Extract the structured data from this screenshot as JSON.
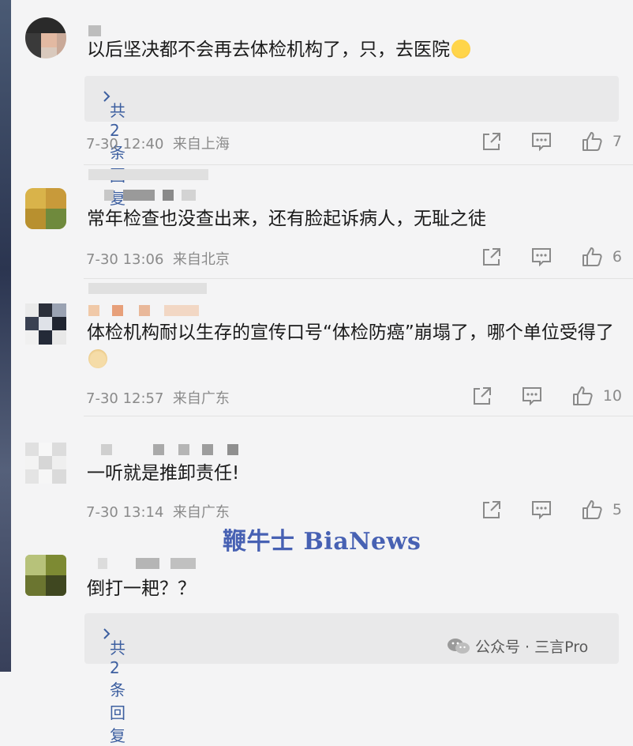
{
  "comments": [
    {
      "text": "以后坚决都不会再去体检机构了，只，去医院",
      "reply_label": "共2条回复",
      "time": "7-30 12:40",
      "location": "来自上海",
      "likes": "7"
    },
    {
      "text": "常年检查也没查出来，还有脸起诉病人，无耻之徒",
      "time": "7-30 13:06",
      "location": "来自北京",
      "likes": "6"
    },
    {
      "text": "体检机构耐以生存的宣传口号“体检防癌”崩塌了，哪个单位受得了",
      "time": "7-30 12:57",
      "location": "来自广东",
      "likes": "10"
    },
    {
      "text": "一听就是推卸责任!",
      "time": "7-30 13:14",
      "location": "来自广东",
      "likes": "5"
    },
    {
      "text": "倒打一耙？？",
      "reply_label": "共2条回复"
    }
  ],
  "watermark": "鞭牛士 BiaNews",
  "footer_account": "公众号 · 三言Pro",
  "icons": [
    "share-icon",
    "comment-icon",
    "thumbs-up-icon",
    "chevron-right-icon",
    "wechat-icon"
  ]
}
